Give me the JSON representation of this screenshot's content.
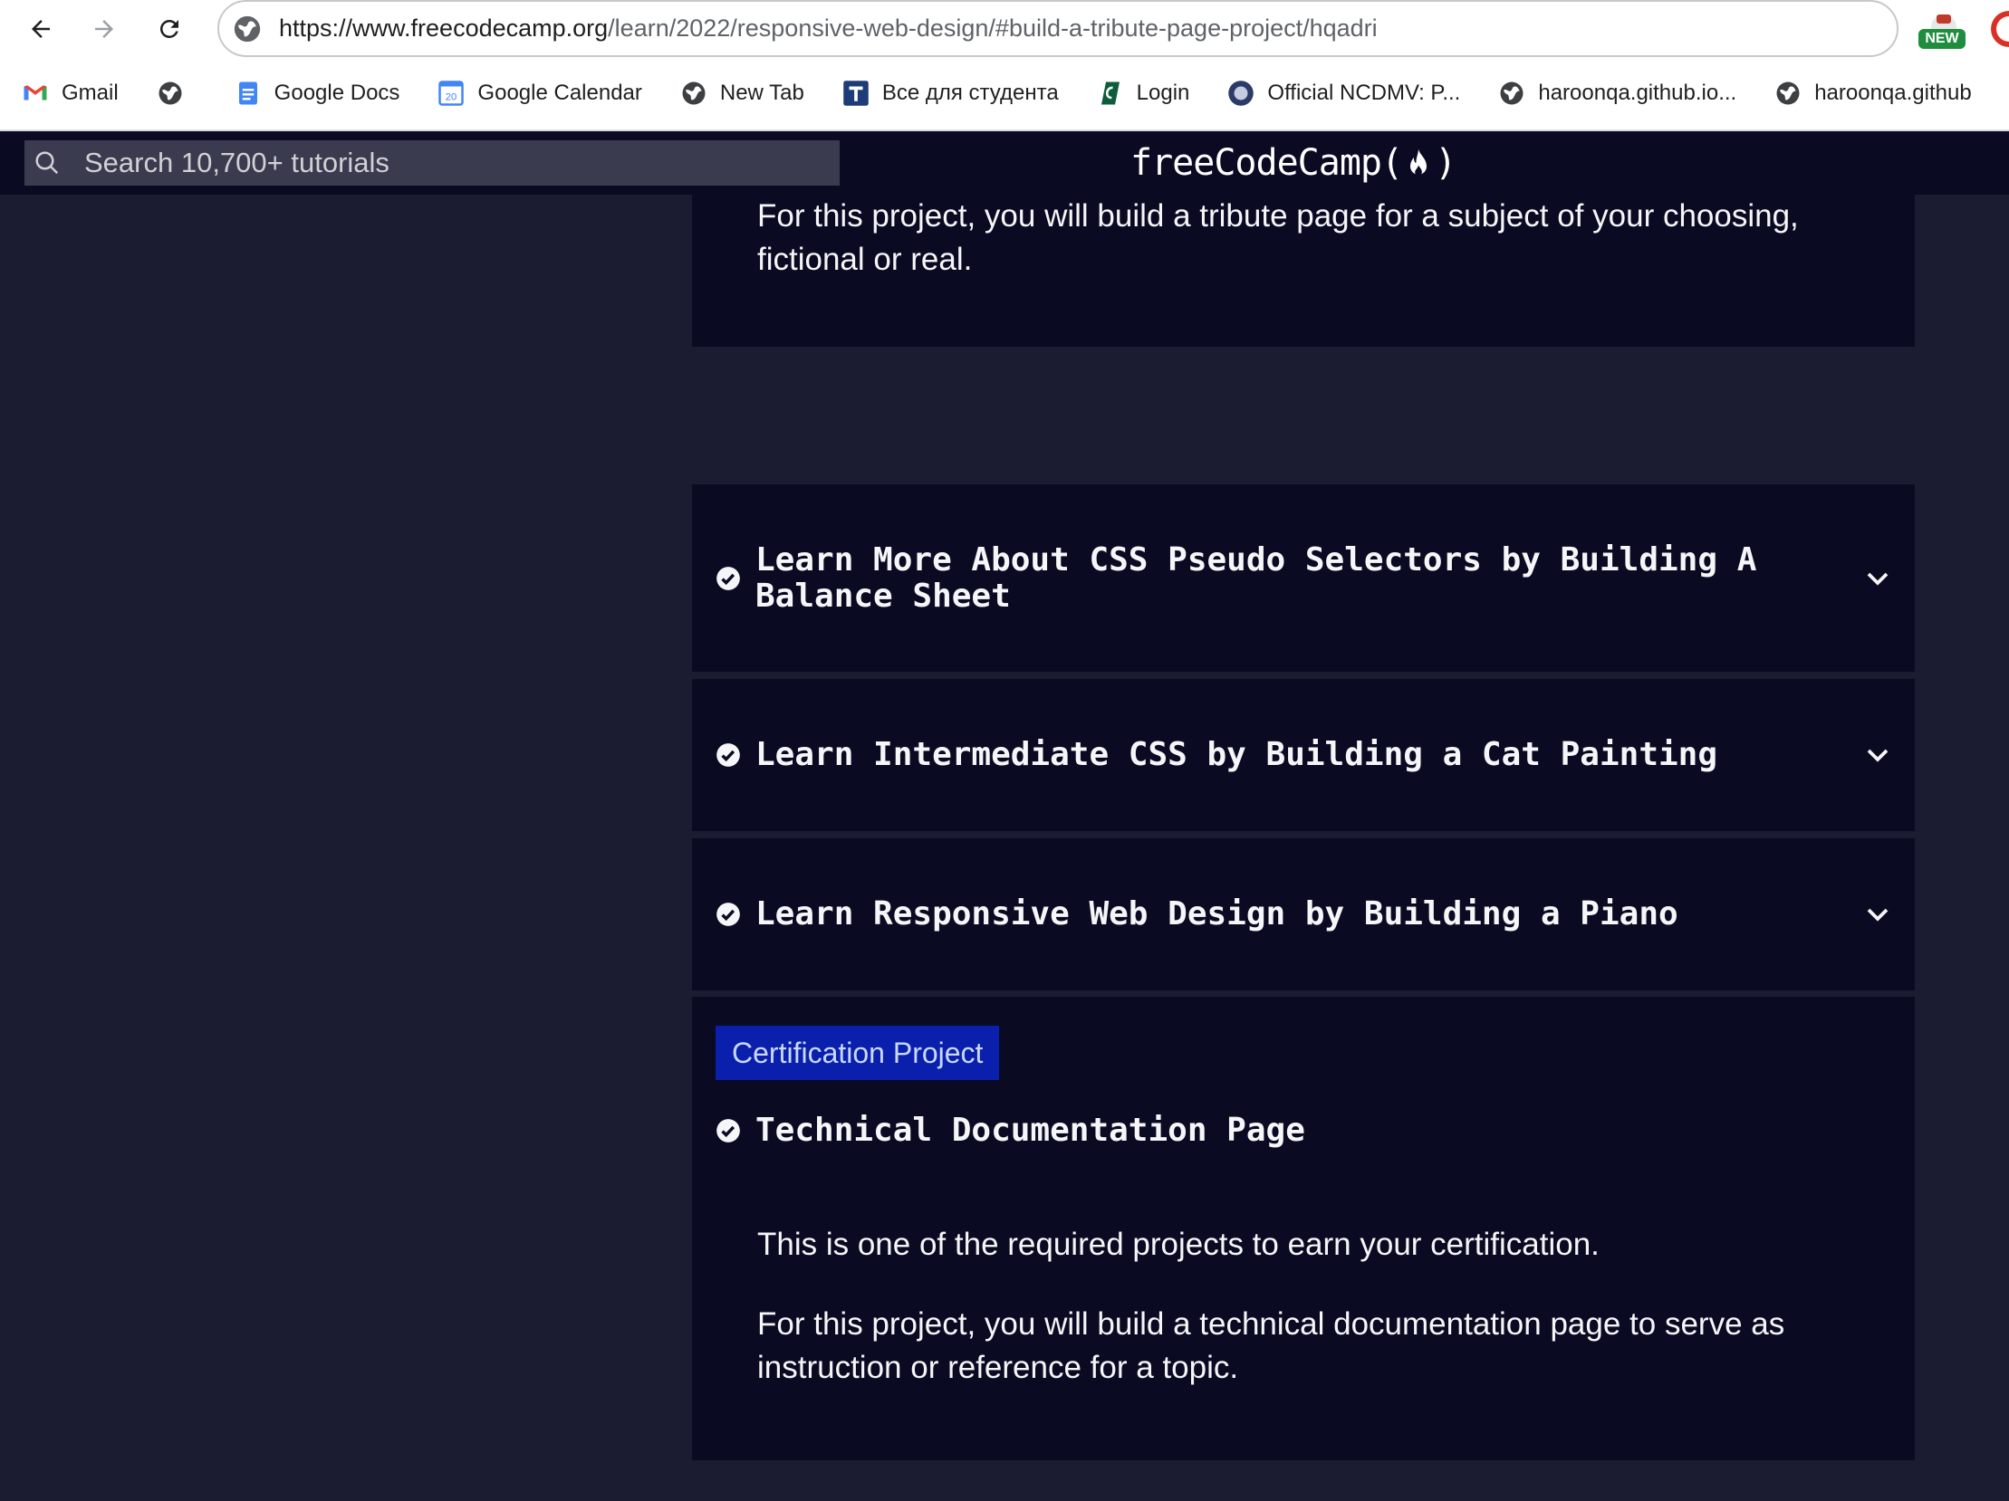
{
  "browser": {
    "url_host": "https://www.freecodecamp.org",
    "url_path": "/learn/2022/responsive-web-design/#build-a-tribute-page-project/hqadri",
    "extension_badge": "NEW"
  },
  "bookmarks": [
    {
      "label": "Gmail",
      "icon": "gmail-icon"
    },
    {
      "label": "",
      "icon": "globe-icon"
    },
    {
      "label": "Google Docs",
      "icon": "google-docs-icon"
    },
    {
      "label": "Google Calendar",
      "icon": "google-calendar-icon"
    },
    {
      "label": "New Tab",
      "icon": "globe-icon"
    },
    {
      "label": "Все для студента",
      "icon": "t-icon"
    },
    {
      "label": "Login",
      "icon": "login-icon"
    },
    {
      "label": "Official NCDMV: P...",
      "icon": "ncdmv-icon"
    },
    {
      "label": "haroonqa.github.io...",
      "icon": "globe-icon"
    },
    {
      "label": "haroonqa.github",
      "icon": "globe-icon"
    }
  ],
  "calendar_icon_day": "20",
  "fcc_nav": {
    "search_placeholder": "Search 10,700+ tutorials",
    "logo_left": "freeCodeCamp(",
    "logo_right": ")"
  },
  "tribute": {
    "description": "For this project, you will build a tribute page for a subject of your choosing, fictional or real."
  },
  "blocks": [
    {
      "title": "Learn More About CSS Pseudo Selectors by Building A Balance Sheet",
      "completed": true
    },
    {
      "title": "Learn Intermediate CSS by Building a Cat Painting",
      "completed": true
    },
    {
      "title": "Learn Responsive Web Design by Building a Piano",
      "completed": true
    }
  ],
  "certification": {
    "tag": "Certification Project",
    "title": "Technical Documentation Page",
    "paragraph1": "This is one of the required projects to earn your certification.",
    "paragraph2": "For this project, you will build a technical documentation page to serve as instruction or reference for a topic."
  },
  "colors": {
    "page_bg": "#1b1b32",
    "panel_bg": "#0a0a23",
    "text": "#f5f6f7",
    "cert_tag_bg": "#0a1fac"
  }
}
